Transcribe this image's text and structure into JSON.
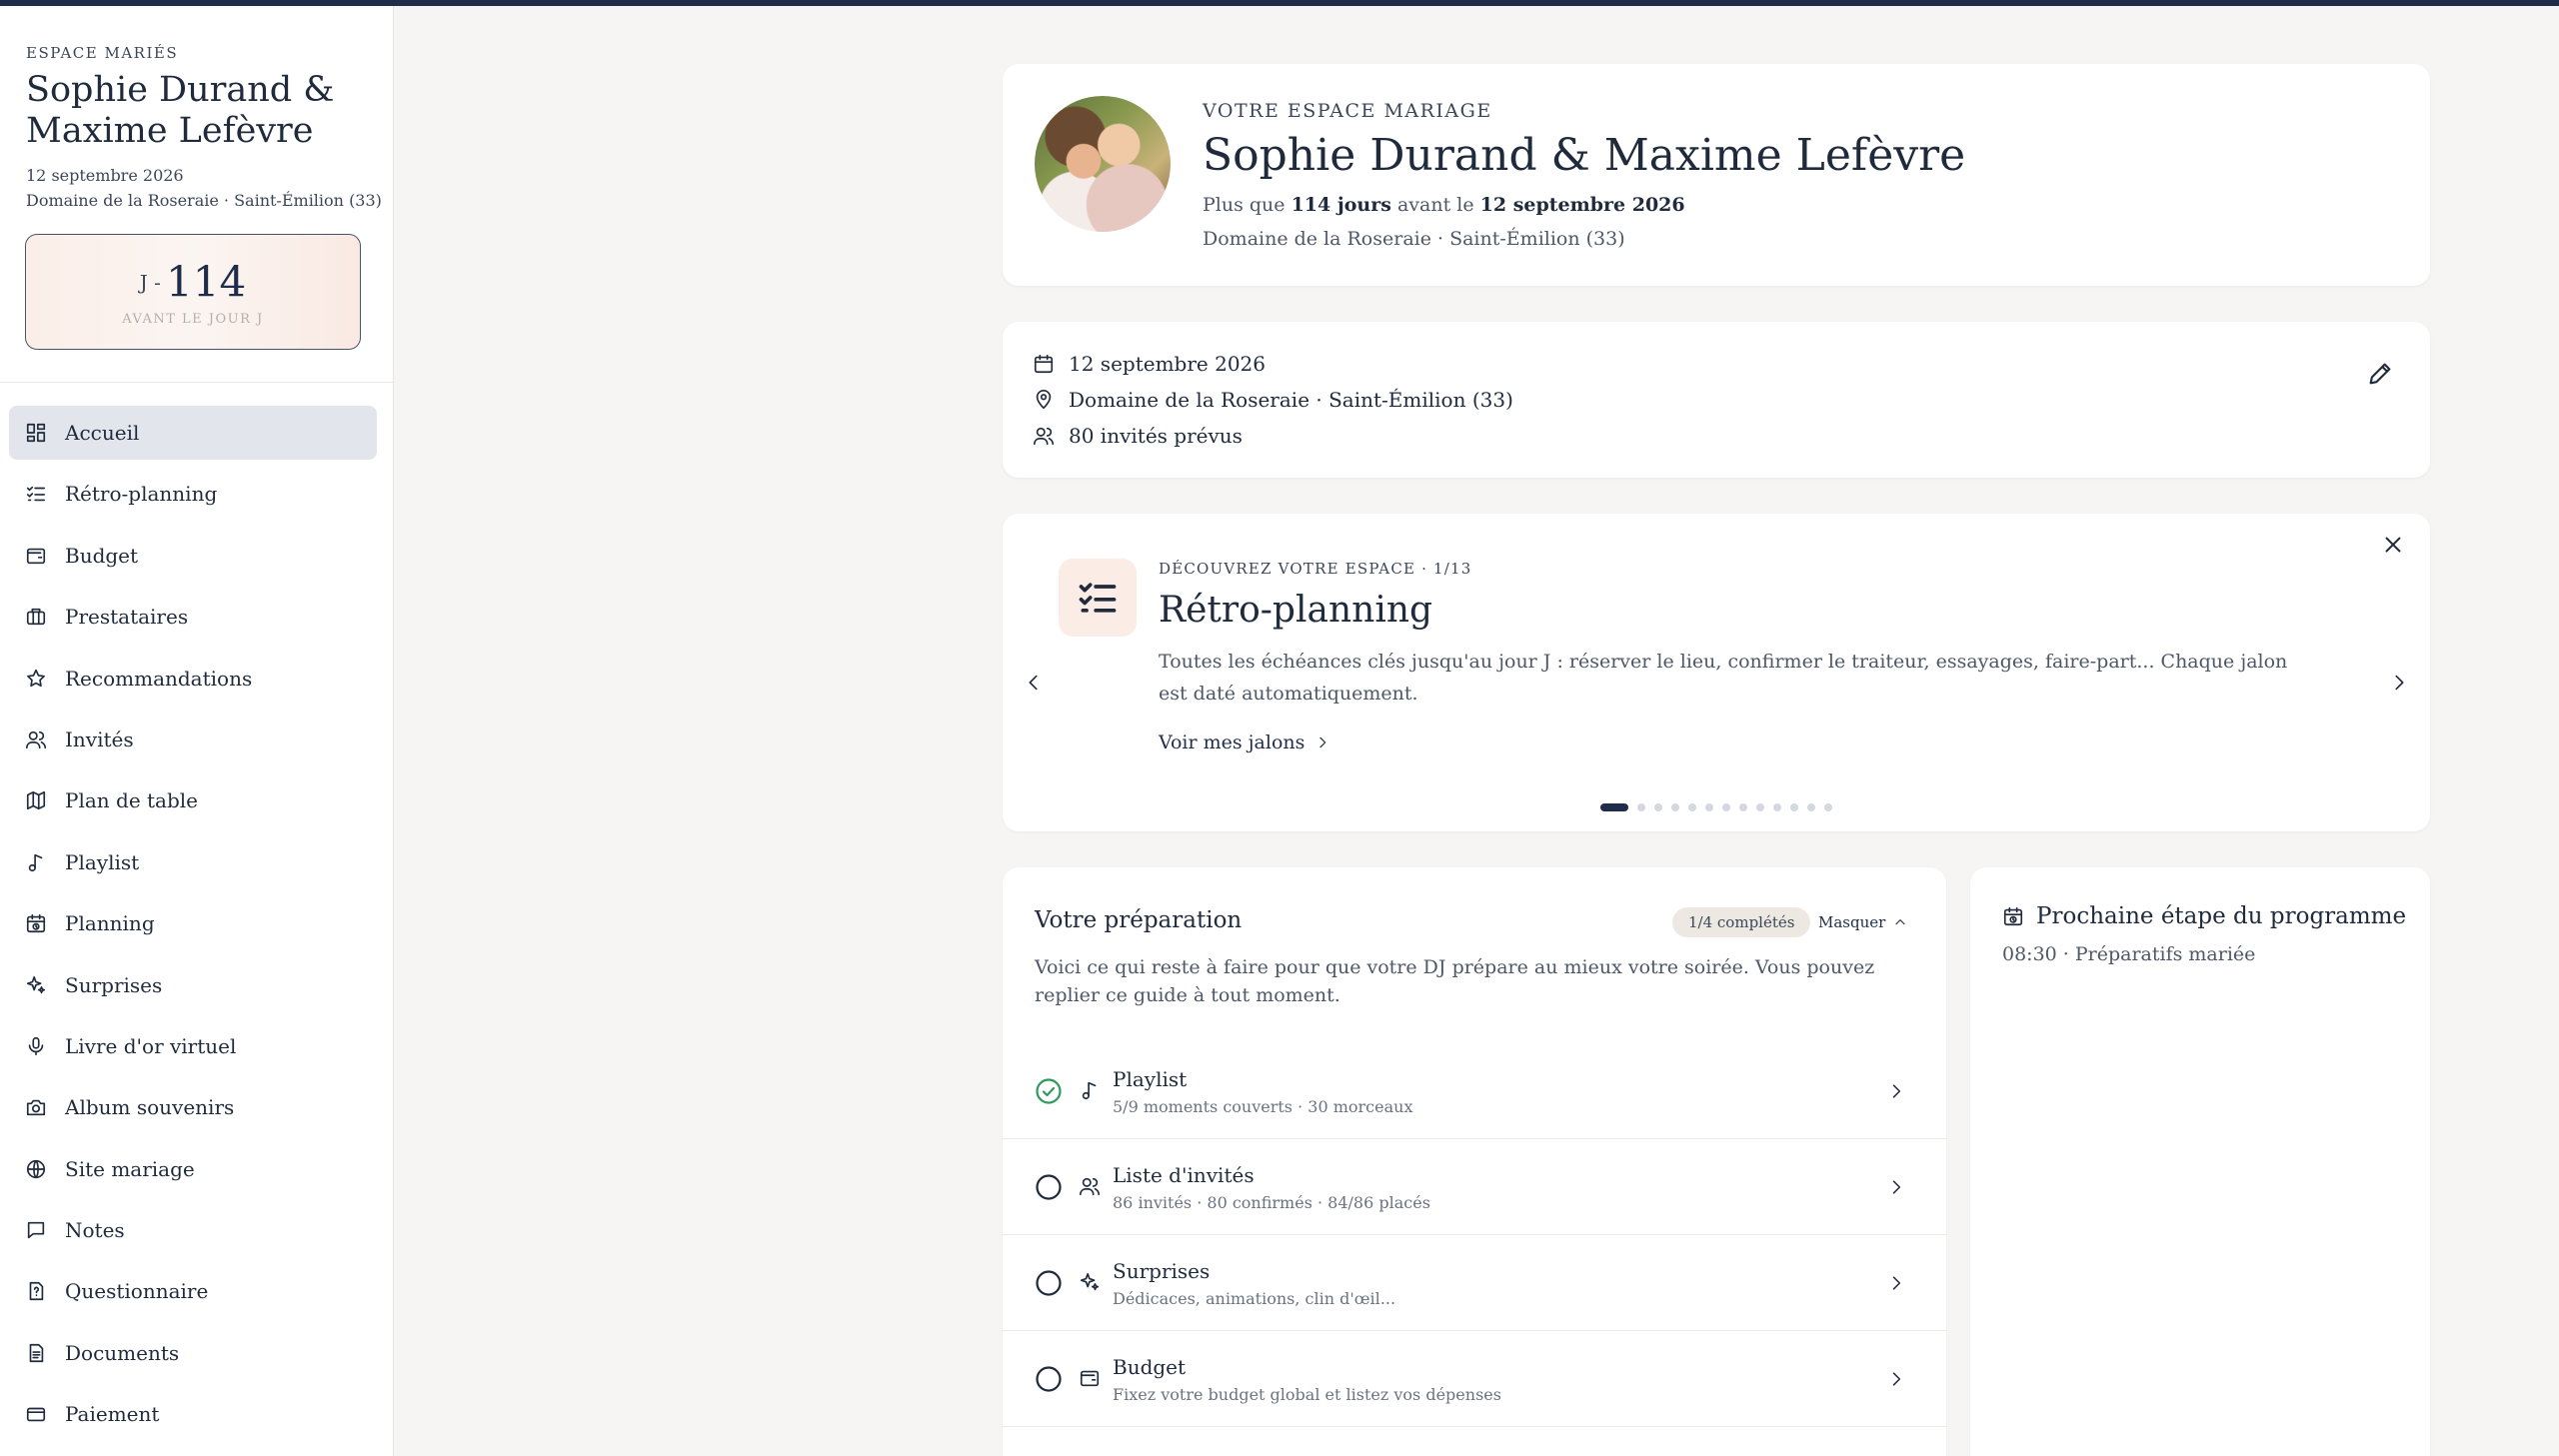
{
  "sidebar": {
    "kicker": "ESPACE MARIÉS",
    "names": "Sophie Durand & Maxime Lefèvre",
    "date": "12 septembre 2026",
    "venue": "Domaine de la Roseraie · Saint-Émilion (33)",
    "countdown": {
      "prefix": "J -",
      "days": "114",
      "label": "AVANT LE JOUR J"
    },
    "nav": [
      {
        "label": "Accueil",
        "icon": "dashboard-icon"
      },
      {
        "label": "Rétro-planning",
        "icon": "checklist-icon"
      },
      {
        "label": "Budget",
        "icon": "wallet-icon"
      },
      {
        "label": "Prestataires",
        "icon": "briefcase-icon"
      },
      {
        "label": "Recommandations",
        "icon": "star-icon"
      },
      {
        "label": "Invités",
        "icon": "users-icon"
      },
      {
        "label": "Plan de table",
        "icon": "map-icon"
      },
      {
        "label": "Playlist",
        "icon": "music-note-icon"
      },
      {
        "label": "Planning",
        "icon": "calendar-clock-icon"
      },
      {
        "label": "Surprises",
        "icon": "sparkles-icon"
      },
      {
        "label": "Livre d'or virtuel",
        "icon": "microphone-icon"
      },
      {
        "label": "Album souvenirs",
        "icon": "camera-icon"
      },
      {
        "label": "Site mariage",
        "icon": "globe-icon"
      },
      {
        "label": "Notes",
        "icon": "message-square-icon"
      },
      {
        "label": "Questionnaire",
        "icon": "help-file-icon"
      },
      {
        "label": "Documents",
        "icon": "file-text-icon"
      },
      {
        "label": "Paiement",
        "icon": "credit-card-icon"
      }
    ]
  },
  "hero": {
    "kicker": "VOTRE ESPACE MARIAGE",
    "title": "Sophie Durand & Maxime Lefèvre",
    "line_prefix": "Plus que",
    "days": "114 jours",
    "line_middle": "avant le",
    "date": "12 septembre 2026",
    "venue": "Domaine de la Roseraie · Saint-Émilion (33)"
  },
  "infos": {
    "date": "12 septembre 2026",
    "venue": "Domaine de la Roseraie · Saint-Émilion (33)",
    "guests": "80 invités prévus"
  },
  "discover": {
    "kicker": "DÉCOUVREZ VOTRE ESPACE · 1/13",
    "title": "Rétro-planning",
    "text": "Toutes les échéances clés jusqu'au jour J : réserver le lieu, confirmer le traiteur, essayages, faire-part... Chaque jalon est daté automatiquement.",
    "link": "Voir mes jalons",
    "pages_total": 13,
    "page_current": 1
  },
  "prep": {
    "title": "Votre préparation",
    "badge": "1/4 complétés",
    "hide": "Masquer",
    "desc": "Voici ce qui reste à faire pour que votre DJ prépare au mieux votre soirée. Vous pouvez replier ce guide à tout moment.",
    "items": [
      {
        "title": "Playlist",
        "sub": "5/9 moments couverts · 30 morceaux",
        "done": true,
        "icon": "music-note-icon"
      },
      {
        "title": "Liste d'invités",
        "sub": "86 invités · 80 confirmés · 84/86 placés",
        "done": false,
        "icon": "users-icon"
      },
      {
        "title": "Surprises",
        "sub": "Dédicaces, animations, clin d'œil...",
        "done": false,
        "icon": "sparkles-icon"
      },
      {
        "title": "Budget",
        "sub": "Fixez votre budget global et listez vos dépenses",
        "done": false,
        "icon": "wallet-icon"
      }
    ]
  },
  "next": {
    "title": "Prochaine étape du programme",
    "item": "08:30 · Préparatifs mariée"
  },
  "colors": {
    "accent": "#1f2d4a",
    "success": "#2e9a5e",
    "nav_active": "#e2e6ec"
  }
}
